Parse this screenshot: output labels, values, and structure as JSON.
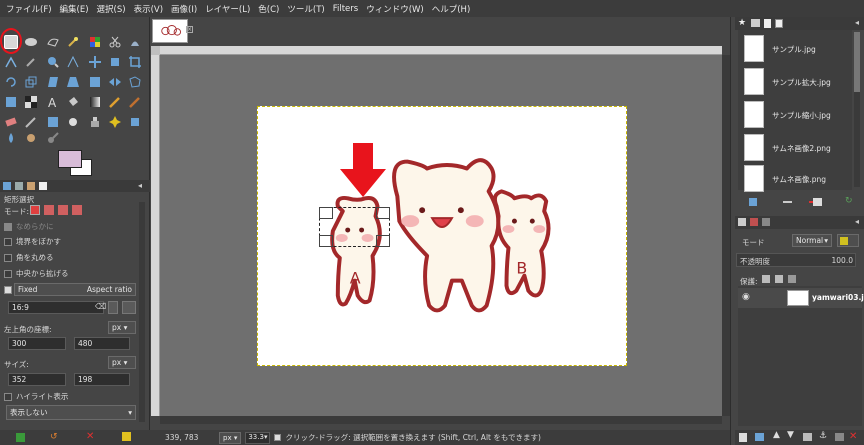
{
  "menubar": [
    "ファイル(F)",
    "編集(E)",
    "選択(S)",
    "表示(V)",
    "画像(I)",
    "レイヤー(L)",
    "色(C)",
    "ツール(T)",
    "Filters",
    "ウィンドウ(W)",
    "ヘルプ(H)"
  ],
  "tool_options": {
    "title": "矩形選択",
    "mode_label": "モード:",
    "antialias": "なめらかに",
    "feather": "境界をぼかす",
    "rounded": "角を丸める",
    "from_center": "中央から拡げる",
    "fixed_label": "Fixed",
    "fixed_option": "Aspect ratio",
    "ratio_value": "16:9",
    "position_label": "左上角の座標:",
    "position_unit": "px",
    "pos_x": "300",
    "pos_y": "480",
    "size_label": "サイズ:",
    "size_unit": "px",
    "size_w": "352",
    "size_h": "198",
    "highlight": "ハイライト表示",
    "guides": "表示しない"
  },
  "canvas": {
    "char_a": "A",
    "char_b": "B"
  },
  "statusbar": {
    "coords": "339, 783",
    "unit": "px",
    "zoom": "33.3",
    "message": "クリック-ドラッグ: 選択範囲を置き換えます (Shift, Ctrl, Alt をもできます)"
  },
  "images_list": [
    "サンプル.jpg",
    "サンプル拡大.jpg",
    "サンプル縮小.jpg",
    "サムネ画像2.png",
    "サムネ画像.png"
  ],
  "layers": {
    "mode_label": "モード",
    "mode_value": "Normal",
    "opacity_label": "不透明度",
    "opacity_value": "100.0",
    "lock_label": "保護:",
    "layer_name": "yamwari03.jpg"
  },
  "colors": {
    "accent_red": "#e8141c",
    "fg": "#d8bcd8",
    "bg": "#ffffff",
    "bear_outline": "#a3282a"
  }
}
